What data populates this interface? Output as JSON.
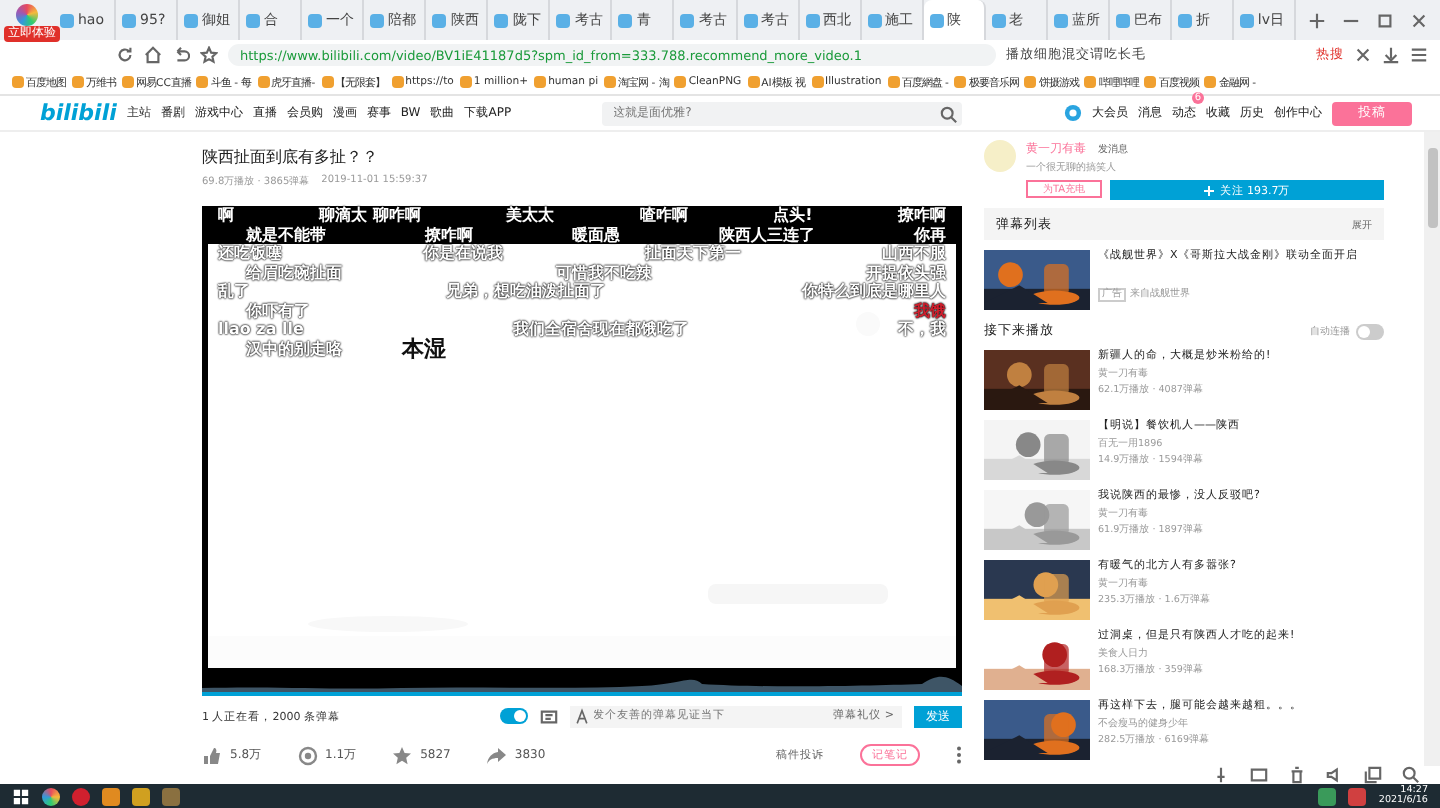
{
  "browser": {
    "badge": "立即体验",
    "tabs": [
      {
        "label": "hao",
        "selected": false
      },
      {
        "label": "95?",
        "selected": false
      },
      {
        "label": "御姐",
        "selected": false
      },
      {
        "label": "合",
        "selected": false
      },
      {
        "label": "一个",
        "selected": false
      },
      {
        "label": "陪都",
        "selected": false
      },
      {
        "label": "陕西",
        "selected": false
      },
      {
        "label": "陇下",
        "selected": false
      },
      {
        "label": "考古",
        "selected": false
      },
      {
        "label": "青",
        "selected": false
      },
      {
        "label": "考古",
        "selected": false
      },
      {
        "label": "考古",
        "selected": false
      },
      {
        "label": "西北",
        "selected": false
      },
      {
        "label": "施工",
        "selected": false
      },
      {
        "label": "陕",
        "selected": true
      },
      {
        "label": "老",
        "selected": false
      },
      {
        "label": "蓝所",
        "selected": false
      },
      {
        "label": "巴布",
        "selected": false
      },
      {
        "label": "折",
        "selected": false
      },
      {
        "label": "lv日",
        "selected": false
      }
    ],
    "url": "https://www.bilibili.com/video/BV1iE41187d5?spm_id_from=333.788.recommend_more_video.1",
    "search": {
      "value": "播放细胞混交谓吃长毛"
    },
    "hot": "热搜",
    "bookmarks": [
      "百度地图",
      "万维书",
      "网易CC直播",
      "斗鱼 - 每",
      "虎牙直播-",
      "【无限套】",
      "https://to",
      "1 million+",
      "human pi",
      "淘宝网 - 淘",
      "CleanPNG",
      "AI模板 视",
      "Illustration",
      "百度網盘 -",
      "极要音乐网",
      "饼摄游戏",
      "哔哩哔哩",
      "百度视频",
      "金融网 -"
    ]
  },
  "site_header": {
    "logo": "bilibili",
    "logo_sub": "主站",
    "nav": [
      "番剧",
      "游戏中心",
      "直播",
      "会员购",
      "漫画",
      "赛事",
      "BW",
      "歌曲"
    ],
    "download": "下载APP",
    "search": {
      "placeholder": "这就是面优雅?"
    },
    "user_menu": [
      {
        "label": "大会员"
      },
      {
        "label": "消息"
      },
      {
        "label": "动态",
        "badge": "6"
      },
      {
        "label": "收藏"
      },
      {
        "label": "历史"
      },
      {
        "label": "创作中心"
      }
    ],
    "upload": "投稿"
  },
  "video": {
    "title": "陕西扯面到底有多扯？？",
    "views": "69.8万播放 · 3865弹幕",
    "date": "2019-11-01 15:59:37",
    "danmaku_rows": [
      [
        {
          "text": "啊",
          "color": "#ffffff"
        },
        {
          "text": "聊滴太 聊咋啊",
          "color": "#ffffff"
        },
        {
          "text": "美太太",
          "color": "#ffffff"
        },
        {
          "text": "喳咋啊",
          "color": "#ffffff"
        },
        {
          "text": "点头!",
          "color": "#ffffff"
        },
        {
          "text": "撩咋啊",
          "color": "#ffffff"
        }
      ],
      [
        {
          "text": "就是不能带",
          "color": "#ffffff"
        },
        {
          "text": "撩咋啊",
          "color": "#ffffff"
        },
        {
          "text": "暖面愚",
          "color": "#ffffff"
        },
        {
          "text": "陕西人三连了",
          "color": "#ffffff"
        },
        {
          "text": "你再",
          "color": "#ffffff"
        }
      ],
      [
        {
          "text": "还吃饭噻",
          "color": "#ffffff"
        },
        {
          "text": "你是在说我",
          "color": "#ffffff"
        },
        {
          "text": "扯面天下第一",
          "color": "#ffffff"
        },
        {
          "text": "山西不服",
          "color": "#ffffff"
        }
      ],
      [
        {
          "text": "给眉吃碗扯面",
          "color": "#ffffff"
        },
        {
          "text": "可惜我不吃辣",
          "color": "#ffffff"
        },
        {
          "text": "开提依头强",
          "color": "#ffffff"
        }
      ],
      [
        {
          "text": "乱了",
          "color": "#ffffff"
        },
        {
          "text": "兄弟，想吃油泼扯面了",
          "color": "#ffffff"
        },
        {
          "text": "你特么到底是哪里人",
          "color": "#ffffff"
        }
      ],
      [
        {
          "text": "你吓有了",
          "color": "#ffffff"
        },
        {
          "text": "我饿",
          "color": "#d0202e"
        }
      ],
      [
        {
          "text": "llao za lle",
          "color": "#ffffff"
        },
        {
          "text": "我们全宿舍现在都饿吃了",
          "color": "#ffffff"
        },
        {
          "text": "不，我",
          "color": "#ffffff"
        }
      ],
      [
        {
          "text": "汉中的别走咯",
          "color": "#ffffff"
        },
        {
          "text": "本湿",
          "color": "#111111"
        }
      ]
    ],
    "viewers": "1 人正在看，2000 条弹幕",
    "danmaku_on": true,
    "danmaku_placeholder": "发个友善的弹幕见证当下",
    "etiquette": "弹幕礼仪 >",
    "send": "发送",
    "actions": [
      {
        "kind": "like",
        "count": "5.8万"
      },
      {
        "kind": "coin",
        "count": "1.1万"
      },
      {
        "kind": "favorite",
        "count": "5827"
      },
      {
        "kind": "share",
        "count": "3830"
      }
    ],
    "report": "稿件投诉",
    "notes": "记笔记"
  },
  "uploader": {
    "name": "黄一刀有毒",
    "message": "发消息",
    "bio": "一个很无聊的搞笑人",
    "charge": "为TA充电",
    "follow": "关注 193.7万"
  },
  "danmaku_list": {
    "title": "弹幕列表",
    "expand": "展开"
  },
  "ad": {
    "title": "《战舰世界》X《哥斯拉大战金刚》联动全面开启",
    "tag": "广告",
    "source": "来自战舰世界"
  },
  "up_next": {
    "title": "接下来播放",
    "autoplay_label": "自动连播",
    "autoplay": false
  },
  "recommendations": [
    {
      "title": "新疆人的命，大概是炒米粉给的!",
      "author": "黄一刀有毒",
      "stats": "62.1万播放 · 4087弹幕"
    },
    {
      "title": "【明说】餐饮机人——陕西",
      "author": "百无一用1896",
      "stats": "14.9万播放 · 1594弹幕"
    },
    {
      "title": "我说陕西的最惨，没人反驳吧?",
      "author": "黄一刀有毒",
      "stats": "61.9万播放 · 1897弹幕"
    },
    {
      "title": "有暖气的北方人有多嚣张?",
      "author": "黄一刀有毒",
      "stats": "235.3万播放 · 1.6万弹幕"
    },
    {
      "title": "过洞桌，但是只有陕西人才吃的起来!",
      "author": "美食人日力",
      "stats": "168.3万播放 · 359弹幕"
    },
    {
      "title": "再这样下去，腿可能会越来越粗。。。",
      "author": "不会瘦马的健身少年",
      "stats": "282.5万播放 · 6169弹幕"
    }
  ],
  "taskbar": {
    "time": "14:27",
    "date": "2021/6/16"
  }
}
